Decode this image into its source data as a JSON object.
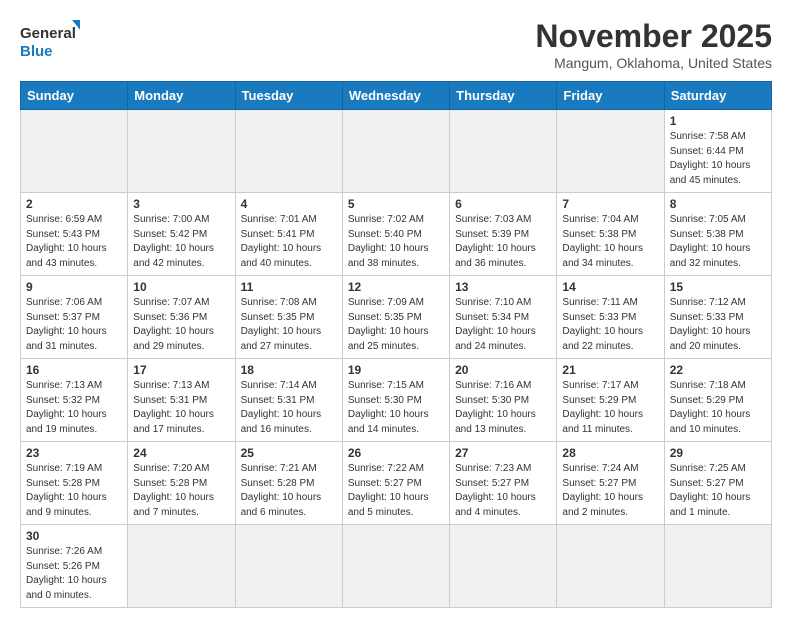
{
  "logo": {
    "line1": "General",
    "line2": "Blue"
  },
  "header": {
    "month": "November 2025",
    "location": "Mangum, Oklahoma, United States"
  },
  "weekdays": [
    "Sunday",
    "Monday",
    "Tuesday",
    "Wednesday",
    "Thursday",
    "Friday",
    "Saturday"
  ],
  "weeks": [
    [
      {
        "day": "",
        "empty": true
      },
      {
        "day": "",
        "empty": true
      },
      {
        "day": "",
        "empty": true
      },
      {
        "day": "",
        "empty": true
      },
      {
        "day": "",
        "empty": true
      },
      {
        "day": "",
        "empty": true
      },
      {
        "day": "1",
        "info": "Sunrise: 7:58 AM\nSunset: 6:44 PM\nDaylight: 10 hours\nand 45 minutes."
      }
    ],
    [
      {
        "day": "2",
        "info": "Sunrise: 6:59 AM\nSunset: 5:43 PM\nDaylight: 10 hours\nand 43 minutes."
      },
      {
        "day": "3",
        "info": "Sunrise: 7:00 AM\nSunset: 5:42 PM\nDaylight: 10 hours\nand 42 minutes."
      },
      {
        "day": "4",
        "info": "Sunrise: 7:01 AM\nSunset: 5:41 PM\nDaylight: 10 hours\nand 40 minutes."
      },
      {
        "day": "5",
        "info": "Sunrise: 7:02 AM\nSunset: 5:40 PM\nDaylight: 10 hours\nand 38 minutes."
      },
      {
        "day": "6",
        "info": "Sunrise: 7:03 AM\nSunset: 5:39 PM\nDaylight: 10 hours\nand 36 minutes."
      },
      {
        "day": "7",
        "info": "Sunrise: 7:04 AM\nSunset: 5:38 PM\nDaylight: 10 hours\nand 34 minutes."
      },
      {
        "day": "8",
        "info": "Sunrise: 7:05 AM\nSunset: 5:38 PM\nDaylight: 10 hours\nand 32 minutes."
      }
    ],
    [
      {
        "day": "9",
        "info": "Sunrise: 7:06 AM\nSunset: 5:37 PM\nDaylight: 10 hours\nand 31 minutes."
      },
      {
        "day": "10",
        "info": "Sunrise: 7:07 AM\nSunset: 5:36 PM\nDaylight: 10 hours\nand 29 minutes."
      },
      {
        "day": "11",
        "info": "Sunrise: 7:08 AM\nSunset: 5:35 PM\nDaylight: 10 hours\nand 27 minutes."
      },
      {
        "day": "12",
        "info": "Sunrise: 7:09 AM\nSunset: 5:35 PM\nDaylight: 10 hours\nand 25 minutes."
      },
      {
        "day": "13",
        "info": "Sunrise: 7:10 AM\nSunset: 5:34 PM\nDaylight: 10 hours\nand 24 minutes."
      },
      {
        "day": "14",
        "info": "Sunrise: 7:11 AM\nSunset: 5:33 PM\nDaylight: 10 hours\nand 22 minutes."
      },
      {
        "day": "15",
        "info": "Sunrise: 7:12 AM\nSunset: 5:33 PM\nDaylight: 10 hours\nand 20 minutes."
      }
    ],
    [
      {
        "day": "16",
        "info": "Sunrise: 7:13 AM\nSunset: 5:32 PM\nDaylight: 10 hours\nand 19 minutes."
      },
      {
        "day": "17",
        "info": "Sunrise: 7:13 AM\nSunset: 5:31 PM\nDaylight: 10 hours\nand 17 minutes."
      },
      {
        "day": "18",
        "info": "Sunrise: 7:14 AM\nSunset: 5:31 PM\nDaylight: 10 hours\nand 16 minutes."
      },
      {
        "day": "19",
        "info": "Sunrise: 7:15 AM\nSunset: 5:30 PM\nDaylight: 10 hours\nand 14 minutes."
      },
      {
        "day": "20",
        "info": "Sunrise: 7:16 AM\nSunset: 5:30 PM\nDaylight: 10 hours\nand 13 minutes."
      },
      {
        "day": "21",
        "info": "Sunrise: 7:17 AM\nSunset: 5:29 PM\nDaylight: 10 hours\nand 11 minutes."
      },
      {
        "day": "22",
        "info": "Sunrise: 7:18 AM\nSunset: 5:29 PM\nDaylight: 10 hours\nand 10 minutes."
      }
    ],
    [
      {
        "day": "23",
        "info": "Sunrise: 7:19 AM\nSunset: 5:28 PM\nDaylight: 10 hours\nand 9 minutes."
      },
      {
        "day": "24",
        "info": "Sunrise: 7:20 AM\nSunset: 5:28 PM\nDaylight: 10 hours\nand 7 minutes."
      },
      {
        "day": "25",
        "info": "Sunrise: 7:21 AM\nSunset: 5:28 PM\nDaylight: 10 hours\nand 6 minutes."
      },
      {
        "day": "26",
        "info": "Sunrise: 7:22 AM\nSunset: 5:27 PM\nDaylight: 10 hours\nand 5 minutes."
      },
      {
        "day": "27",
        "info": "Sunrise: 7:23 AM\nSunset: 5:27 PM\nDaylight: 10 hours\nand 4 minutes."
      },
      {
        "day": "28",
        "info": "Sunrise: 7:24 AM\nSunset: 5:27 PM\nDaylight: 10 hours\nand 2 minutes."
      },
      {
        "day": "29",
        "info": "Sunrise: 7:25 AM\nSunset: 5:27 PM\nDaylight: 10 hours\nand 1 minute."
      }
    ],
    [
      {
        "day": "30",
        "info": "Sunrise: 7:26 AM\nSunset: 5:26 PM\nDaylight: 10 hours\nand 0 minutes."
      },
      {
        "day": "",
        "empty": true
      },
      {
        "day": "",
        "empty": true
      },
      {
        "day": "",
        "empty": true
      },
      {
        "day": "",
        "empty": true
      },
      {
        "day": "",
        "empty": true
      },
      {
        "day": "",
        "empty": true
      }
    ]
  ]
}
